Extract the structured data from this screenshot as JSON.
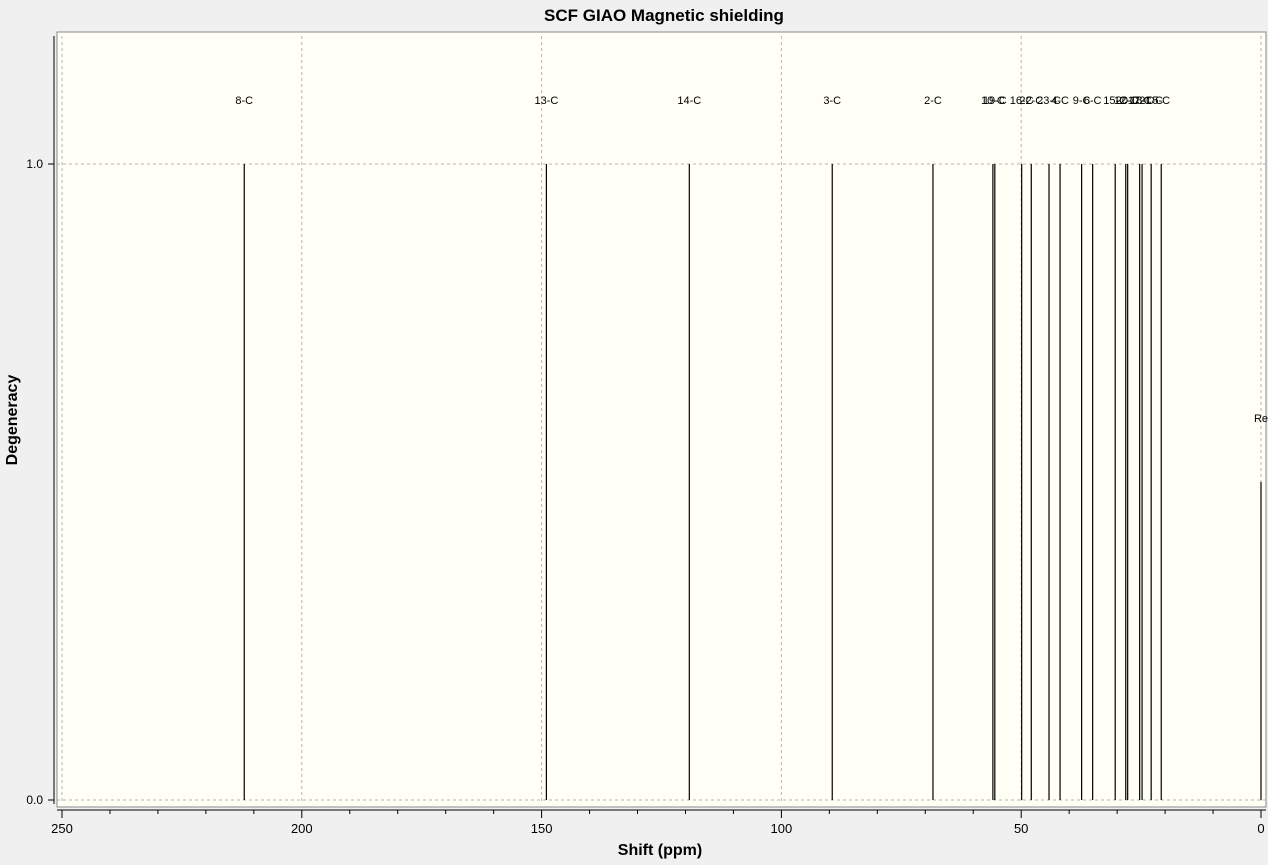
{
  "chart_data": {
    "type": "stick",
    "title": "SCF GIAO Magnetic shielding",
    "xlabel": "Shift (ppm)",
    "ylabel": "Degeneracy",
    "xlim": [
      250,
      0
    ],
    "x_reversed": true,
    "ylim": [
      0.0,
      1.0
    ],
    "x_ticks": [
      250,
      200,
      150,
      100,
      50,
      0
    ],
    "x_tick_labels": [
      "250",
      "200",
      "150",
      "100",
      "50",
      "0"
    ],
    "x_minor_step": 10,
    "y_ticks": [
      0.0,
      1.0
    ],
    "y_tick_labels": [
      "0.0",
      "1.0"
    ],
    "grid": true,
    "colors": {
      "plot_background": "#fffff5",
      "page_background": "#f0f0f0",
      "stick": "#000000",
      "grid": "#b5b5b5"
    },
    "peaks": [
      {
        "label": "8-C",
        "x": 212.0,
        "y": 1.0
      },
      {
        "label": "13-C",
        "x": 149.0,
        "y": 1.0
      },
      {
        "label": "14-C",
        "x": 119.2,
        "y": 1.0
      },
      {
        "label": "3-C",
        "x": 89.4,
        "y": 1.0
      },
      {
        "label": "2-C",
        "x": 68.4,
        "y": 1.0
      },
      {
        "label": "10-C",
        "x": 55.9,
        "y": 1.0
      },
      {
        "label": "19-C",
        "x": 55.5,
        "y": 1.0
      },
      {
        "label": "16-C",
        "x": 49.9,
        "y": 1.0
      },
      {
        "label": "22-C",
        "x": 47.9,
        "y": 1.0
      },
      {
        "label": "23-C",
        "x": 44.2,
        "y": 1.0
      },
      {
        "label": "4-C",
        "x": 41.9,
        "y": 1.0
      },
      {
        "label": "9-C",
        "x": 37.4,
        "y": 1.0
      },
      {
        "label": "6-C",
        "x": 35.1,
        "y": 1.0
      },
      {
        "label": "15-C",
        "x": 30.4,
        "y": 1.0
      },
      {
        "label": "12-C",
        "x": 28.2,
        "y": 1.0
      },
      {
        "label": "20-C",
        "x": 27.8,
        "y": 1.0
      },
      {
        "label": "17-C",
        "x": 25.3,
        "y": 1.0
      },
      {
        "label": "18-C",
        "x": 24.8,
        "y": 1.0
      },
      {
        "label": "21-C",
        "x": 22.9,
        "y": 1.0
      },
      {
        "label": "5-C",
        "x": 20.8,
        "y": 1.0
      },
      {
        "label": "Re",
        "x": 0.0,
        "y": 0.5
      }
    ]
  }
}
